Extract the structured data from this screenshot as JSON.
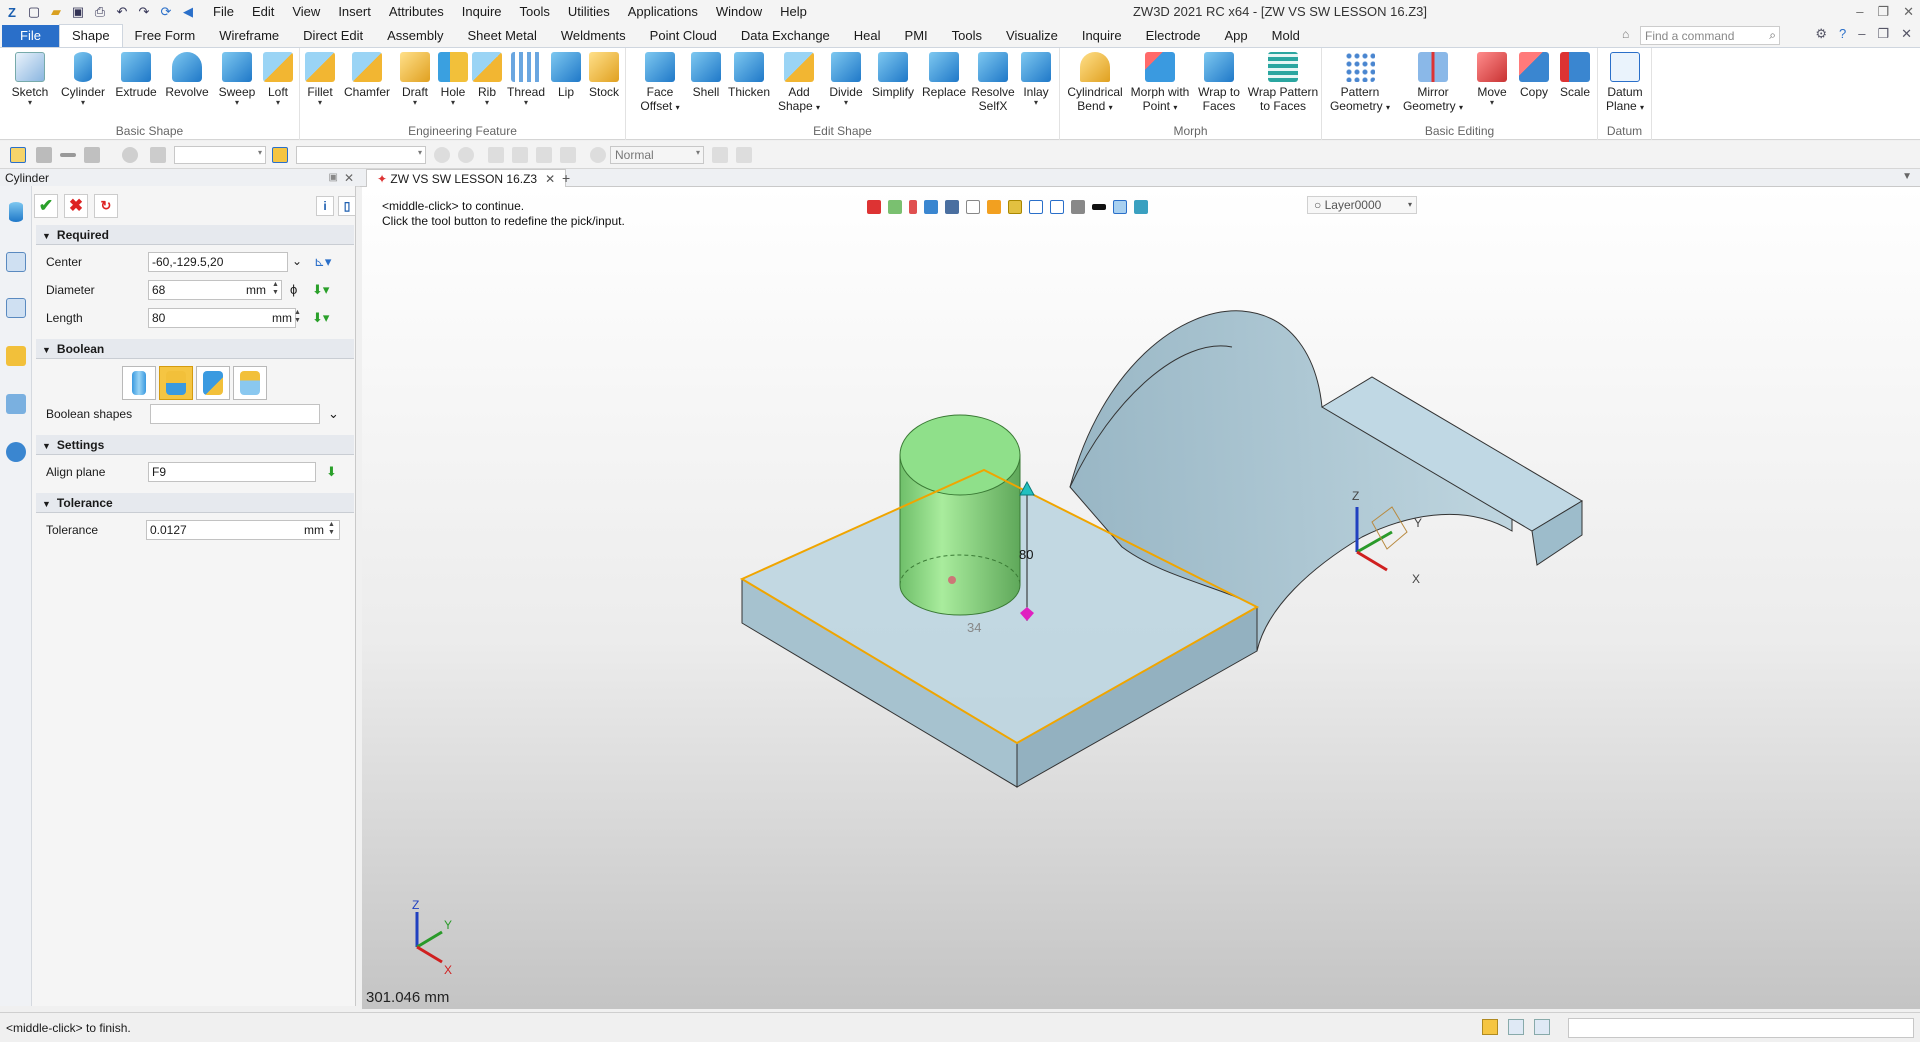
{
  "title": "ZW3D 2021 RC x64 - [ZW VS SW LESSON 16.Z3]",
  "menu": [
    "File",
    "Edit",
    "View",
    "Insert",
    "Attributes",
    "Inquire",
    "Tools",
    "Utilities",
    "Applications",
    "Window",
    "Help"
  ],
  "ribbon_tabs": [
    "File",
    "Shape",
    "Free Form",
    "Wireframe",
    "Direct Edit",
    "Assembly",
    "Sheet Metal",
    "Weldments",
    "Point Cloud",
    "Data Exchange",
    "Heal",
    "PMI",
    "Tools",
    "Visualize",
    "Inquire",
    "Electrode",
    "App",
    "Mold"
  ],
  "active_tab": "Shape",
  "search_placeholder": "Find a command",
  "groups": {
    "basic_shape": {
      "label": "Basic Shape",
      "buttons": [
        "Sketch",
        "Cylinder",
        "Extrude",
        "Revolve",
        "Sweep",
        "Loft"
      ]
    },
    "engineering": {
      "label": "Engineering Feature",
      "buttons": [
        "Fillet",
        "Chamfer",
        "Draft",
        "Hole",
        "Rib",
        "Thread",
        "Lip",
        "Stock"
      ]
    },
    "edit_shape": {
      "label": "Edit Shape",
      "buttons": [
        [
          "Face",
          "Offset"
        ],
        [
          "Shell"
        ],
        [
          "Thicken"
        ],
        [
          "Add",
          "Shape"
        ],
        [
          "Divide"
        ],
        [
          "Simplify"
        ],
        [
          "Replace"
        ],
        [
          "Resolve",
          "SelfX"
        ],
        [
          "Inlay"
        ]
      ]
    },
    "morph": {
      "label": "Morph",
      "buttons": [
        [
          "Cylindrical",
          "Bend"
        ],
        [
          "Morph with",
          "Point"
        ],
        [
          "Wrap to",
          "Faces"
        ],
        [
          "Wrap Pattern",
          "to Faces"
        ]
      ]
    },
    "basic_editing": {
      "label": "Basic Editing",
      "buttons": [
        [
          "Pattern",
          "Geometry"
        ],
        [
          "Mirror",
          "Geometry"
        ],
        [
          "Move"
        ],
        [
          "Copy"
        ],
        [
          "Scale"
        ]
      ]
    },
    "datum": {
      "label": "Datum",
      "buttons": [
        [
          "Datum",
          "Plane"
        ]
      ]
    }
  },
  "toolbar_style": "Normal",
  "panel": {
    "title": "Cylinder",
    "sections": {
      "required": "Required",
      "boolean": "Boolean",
      "settings": "Settings",
      "tolerance": "Tolerance"
    },
    "center": {
      "label": "Center",
      "value": "-60,-129.5,20"
    },
    "diameter": {
      "label": "Diameter",
      "value": "68",
      "unit": "mm"
    },
    "length": {
      "label": "Length",
      "value": "80",
      "unit": "mm"
    },
    "boolean_shapes": {
      "label": "Boolean shapes",
      "value": ""
    },
    "align_plane": {
      "label": "Align plane",
      "value": "F9"
    },
    "tolerance": {
      "label": "Tolerance",
      "value": "0.0127",
      "unit": "mm"
    }
  },
  "doc_tab": "ZW VS SW LESSON 16.Z3",
  "prompt": [
    "<middle-click> to continue.",
    "Click the tool button to redefine the pick/input."
  ],
  "layer": "Layer0000",
  "viewport": {
    "dim_length": "80",
    "dim_diameter": "34",
    "scale": "301.046 mm",
    "axis_labels": {
      "x": "X",
      "y": "Y",
      "z": "Z"
    }
  },
  "status": "<middle-click> to finish.",
  "colors": {
    "accent": "#2a6fc9",
    "cylinder": "#8fe08a",
    "part": "#a9c6d4",
    "highlight": "#f0a500"
  }
}
